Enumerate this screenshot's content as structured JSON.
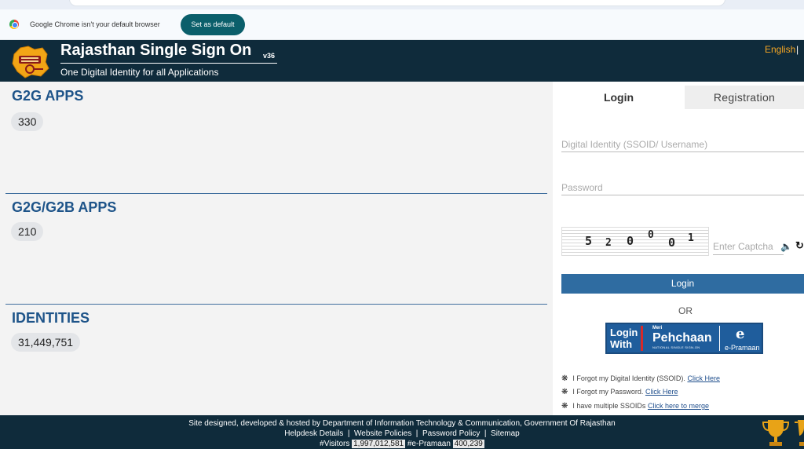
{
  "browser": {
    "infobar_message": "Google Chrome isn't your default browser",
    "set_default_label": "Set as default"
  },
  "header": {
    "title": "Rajasthan Single Sign On",
    "version": "v36",
    "tagline": "One Digital Identity for all Applications",
    "language": "English",
    "language_sep": "|"
  },
  "stats": [
    {
      "label": "G2G APPS",
      "count": "330"
    },
    {
      "label": "G2G/G2B APPS",
      "count": "210"
    },
    {
      "label": "IDENTITIES",
      "count": "31,449,751"
    }
  ],
  "login": {
    "tabs": {
      "login": "Login",
      "registration": "Registration"
    },
    "ssoid_placeholder": "Digital Identity (SSOID/ Username)",
    "password_placeholder": "Password",
    "captcha_digits": [
      "5",
      "2",
      "0",
      "0",
      "0",
      "1"
    ],
    "captcha_placeholder": "Enter Captcha",
    "login_button": "Login",
    "or_text": "OR",
    "pehchaan": {
      "login_with": "Login With",
      "meri": "Meri",
      "name": "Pehchaan",
      "subtitle": "NATIONAL SINGLE SIGN-ON",
      "epramaan": "e-Pramaan",
      "elogo": "e"
    },
    "help_links": [
      {
        "text": "I Forgot my Digital Identity (SSOID).",
        "link": "Click Here"
      },
      {
        "text": "I Forgot my Password.",
        "link": "Click Here"
      },
      {
        "text": "I have multiple SSOIDs",
        "link": "Click here to merge"
      }
    ]
  },
  "footer": {
    "designed_by": "Site designed, developed & hosted by Department of Information Technology & Communication, Government Of Rajasthan",
    "links": [
      "Helpdesk Details",
      "Website Policies",
      "Password Policy",
      "Sitemap"
    ],
    "visitors_label": "#Visitors",
    "visitors_count": "1,997,012,581",
    "epramaan_label": "#e-Pramaan",
    "epramaan_count": "400,239"
  },
  "colors": {
    "header_bg": "#0f2b3b",
    "heading_blue": "#1e5489",
    "login_button": "#2f6ca1",
    "language_link": "#f5a623",
    "set_default": "#0b5f6b"
  },
  "icons": [
    "chrome-logo-icon",
    "rajasthan-logo-icon",
    "speaker-icon",
    "refresh-icon",
    "bullet-icon",
    "trophy-icon"
  ]
}
